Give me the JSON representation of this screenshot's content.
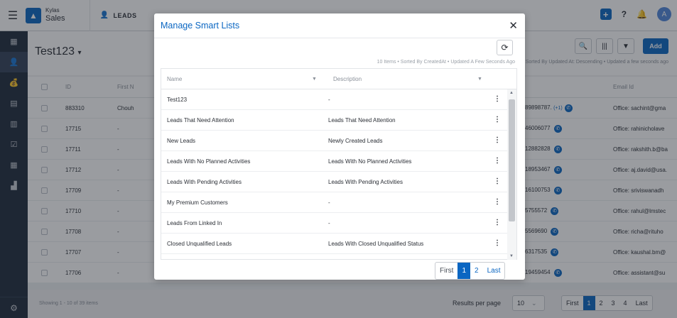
{
  "app": {
    "brand_top": "Kylas",
    "brand_bottom": "Sales",
    "module": "LEADS"
  },
  "topbar": {
    "plus": "+",
    "help": "?",
    "avatar_initial": "A"
  },
  "sidebar": {
    "icons": [
      "dashboard-icon",
      "leads-icon",
      "deals-icon",
      "contacts-icon",
      "companies-icon",
      "tasks-icon",
      "calendar-icon",
      "reports-icon"
    ],
    "active_index": 1,
    "settings_icon": "gear-icon"
  },
  "view": {
    "title": "Test123",
    "add_label": "Add",
    "sort_info": "Sorted By Updated At: Descending • Updated a few seconds ago"
  },
  "grid": {
    "headers": {
      "id": "ID",
      "first": "First N",
      "email": "Email Id"
    },
    "rows": [
      {
        "id": "883310",
        "first": "Chouh",
        "phone": "89898787.",
        "plus": "(+1)",
        "email": "Office: sachint@gma"
      },
      {
        "id": "17715",
        "first": "-",
        "phone": "46006077",
        "plus": "",
        "email": "Office: rahinicholave"
      },
      {
        "id": "17711",
        "first": "-",
        "phone": "12882828",
        "plus": "",
        "email": "Office: rakshith.b@ba"
      },
      {
        "id": "17712",
        "first": "-",
        "phone": "18953467",
        "plus": "",
        "email": "Office: aj.david@usa."
      },
      {
        "id": "17709",
        "first": "-",
        "phone": "16100753",
        "plus": "",
        "email": "Office: sriviswanadh"
      },
      {
        "id": "17710",
        "first": "-",
        "phone": "5755572",
        "plus": "",
        "email": "Office: rahul@lmstec"
      },
      {
        "id": "17708",
        "first": "-",
        "phone": "5569690",
        "plus": "",
        "email": "Office: richa@rituho"
      },
      {
        "id": "17707",
        "first": "-",
        "phone": "6317535",
        "plus": "",
        "email": "Office: kaushal.bm@"
      },
      {
        "id": "17706",
        "first": "-",
        "phone": "19459454",
        "plus": "",
        "email": "Office: assistant@su"
      }
    ],
    "showing": "Showing 1 - 10 of 39 items",
    "rpp_label": "Results per page",
    "rpp_value": "10",
    "pager": [
      "First",
      "1",
      "2",
      "3",
      "4",
      "Last"
    ]
  },
  "modal": {
    "title": "Manage Smart Lists",
    "info": "10 Items • Sorted By CreatedAt • Updated A Few Seconds Ago",
    "col_name": "Name",
    "col_desc": "Description",
    "rows": [
      {
        "name": "Test123",
        "desc": "-"
      },
      {
        "name": "Leads That Need Attention",
        "desc": "Leads That Need Attention"
      },
      {
        "name": "New Leads",
        "desc": "Newly Created Leads"
      },
      {
        "name": "Leads With No Planned Activities",
        "desc": "Leads With No Planned Activities"
      },
      {
        "name": "Leads With Pending Activities",
        "desc": "Leads With Pending Activities"
      },
      {
        "name": "My Premium Customers",
        "desc": "-"
      },
      {
        "name": "Leads From Linked In",
        "desc": "-"
      },
      {
        "name": "Closed Unqualified Leads",
        "desc": "Leads With Closed Unqualified Status"
      }
    ],
    "pager": {
      "first": "First",
      "p1": "1",
      "p2": "2",
      "last": "Last"
    }
  }
}
